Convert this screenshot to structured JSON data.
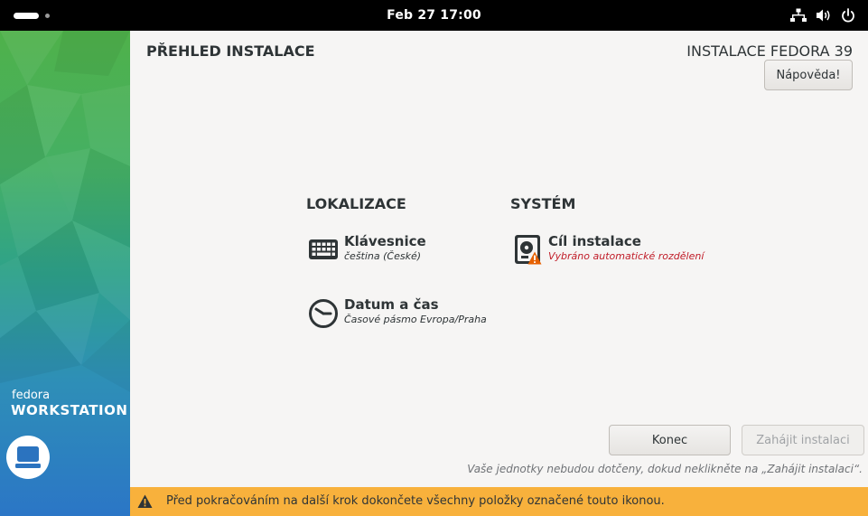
{
  "topbar": {
    "clock": "Feb 27  17:00",
    "icons": [
      "network-icon",
      "volume-icon",
      "power-icon"
    ]
  },
  "sidebar": {
    "brand_top": "fedora",
    "brand_bottom": "WORKSTATION",
    "logo": "workstation-logo-icon"
  },
  "header": {
    "title": "PŘEHLED INSTALACE",
    "product": "INSTALACE FEDORA 39",
    "help_label": "Nápověda!"
  },
  "sections": {
    "localization": {
      "title": "LOKALIZACE",
      "items": [
        {
          "name": "Klávesnice",
          "status": "čeština (České)",
          "icon": "keyboard-icon"
        },
        {
          "name": "Datum a čas",
          "status": "Časové pásmo Evropa/Praha",
          "icon": "clock-icon"
        }
      ]
    },
    "system": {
      "title": "SYSTÉM",
      "items": [
        {
          "name": "Cíl instalace",
          "status": "Vybráno automatické rozdělení",
          "icon": "harddisk-icon",
          "warning": true
        }
      ]
    }
  },
  "footer": {
    "quit_label": "Konec",
    "begin_label": "Zahájit instalaci",
    "note": "Vaše jednotky nebudou dotčeny, dokud neklikněte na „Zahájit instalaci“."
  },
  "warning_bar": {
    "text": "Před pokračováním na další krok dokončete všechny položky označené touto ikonou."
  },
  "colors": {
    "warning_bar": "#f8b13c",
    "warning_text": "#c01c28",
    "topbar": "#000000"
  }
}
